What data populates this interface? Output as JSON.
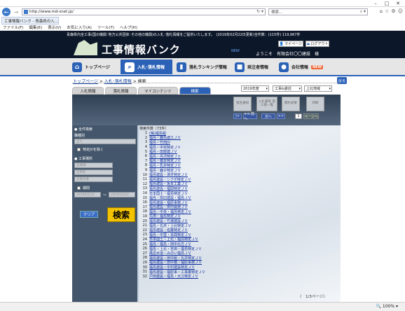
{
  "browser": {
    "address": "http://www.md-snet.jp/",
    "search_placeholder": "検索...",
    "tab_title": "工事情報バンク - 青森県の入...",
    "menu": [
      "ファイル(F)",
      "編集(E)",
      "表示(V)",
      "お気に入り(A)",
      "ツール(T)",
      "ヘルプ(H)"
    ],
    "zoom": "100%"
  },
  "site": {
    "notice": "青森県内全工事(国の機関･地方公共団体･その他の機関)の入札･落札情報をご提供いたします。　(2019年02月22日更新)全件数：(115件) 119,967件",
    "logo_text": "工事情報バンク",
    "mypage": "マイページ",
    "logout": "ログアウト",
    "welcome": "ようこそ　有限会社〇〇建設　様",
    "promo": "NEW"
  },
  "nav": [
    {
      "label": "トップページ",
      "icon": "⌂"
    },
    {
      "label": "入札･落札情報",
      "icon": "🔍"
    },
    {
      "label": "落札ランキング情報",
      "icon": "▮"
    },
    {
      "label": "発注者情報",
      "icon": "■"
    },
    {
      "label": "会社情報",
      "icon": "●",
      "badge": "NEW"
    }
  ],
  "breadcrumb": {
    "home": "トップページ",
    "sep": ">",
    "sec": "入札･落札情報",
    "cur": "検索"
  },
  "subtabs": [
    "入札情報",
    "落札情報",
    "マイコンテンツ",
    "検索"
  ],
  "controls": {
    "year": "2019年度",
    "type": "工事&委託",
    "region": "上北地域",
    "back": "戻る"
  },
  "ops": {
    "btn1": "指名通知",
    "btn2": "入札書等\n第三者一覧",
    "btn3": "開札結果",
    "btn4": "印刷",
    "prev1": "|<",
    "prev2": "<< 前へ",
    "next1": "次へ",
    "next2": ">>",
    "page": "1",
    "page_of": "ページへ"
  },
  "left": {
    "group_label": "● 全件検索",
    "sub1": "職種別",
    "sel1": "全て",
    "cb1": "特定JVを除く",
    "sub2": "● 工事場所",
    "sel2": "全地域",
    "sel3": "全市町",
    "sel4": "全発注者",
    "cb2": "期間",
    "date1": "2019/02/22",
    "tilde": "〜",
    "date2": "2019/02/22",
    "clear": "クリア",
    "search": "検索"
  },
  "results": {
    "header": "検索件数（73件）",
    "pager": "〈　1/3ページ〉",
    "items": [
      "(株)福島組",
      "福島・鹿島建工ＪＶ",
      "福島・竹田JV",
      "福島・中央特定ＪＶ",
      "福島・田部建ＪＶ",
      "福島・丹沢特定ＪＶ",
      "福島・橋本特定ＪＶ",
      "福島・乳井特定ＪＶ",
      "福島・鹿子特定ＪＶ",
      "福島建設・澤井特定ＪＶ",
      "福島建設・シクダ特定ＪＶ",
      "福島建設・坂本工業ＪＶ",
      "福島建設・福岡特定ＪＶ",
      "日本国土・福島特定ＪＶ",
      "福島・田辺建設・福島ＪＶ",
      "福島建設・福原事務ＪＶ",
      "福島建設・田中開発ＪＶ",
      "福島・中央・福島特定ＪＶ",
      "丸田・福島特定ＪＶ",
      "福島建設・竹渡建設ＪＶ",
      "福島・丸井・上北特定ＪＶ",
      "福島建設・佐藤特定ＪＶ",
      "福島・中里・本間特定ＪＶ",
      "日本国土・上北・福島特定ＪＶ",
      "福島・福島・田中北方ＪＶ",
      "福島・上北・吉田・福島特定ＪＶ",
      "風呂水道・みのい福島ＪＶ",
      "福島建設・田中組・丸井特定ＪＶ",
      "福島建設・田中橋・福原事務ＪＶ",
      "福島建設・中村建設特定ＪＶ",
      "福島建設・福原事・工事業特定ＪＶ",
      "戸田建設・福島・大江特定ＪＶ"
    ]
  }
}
